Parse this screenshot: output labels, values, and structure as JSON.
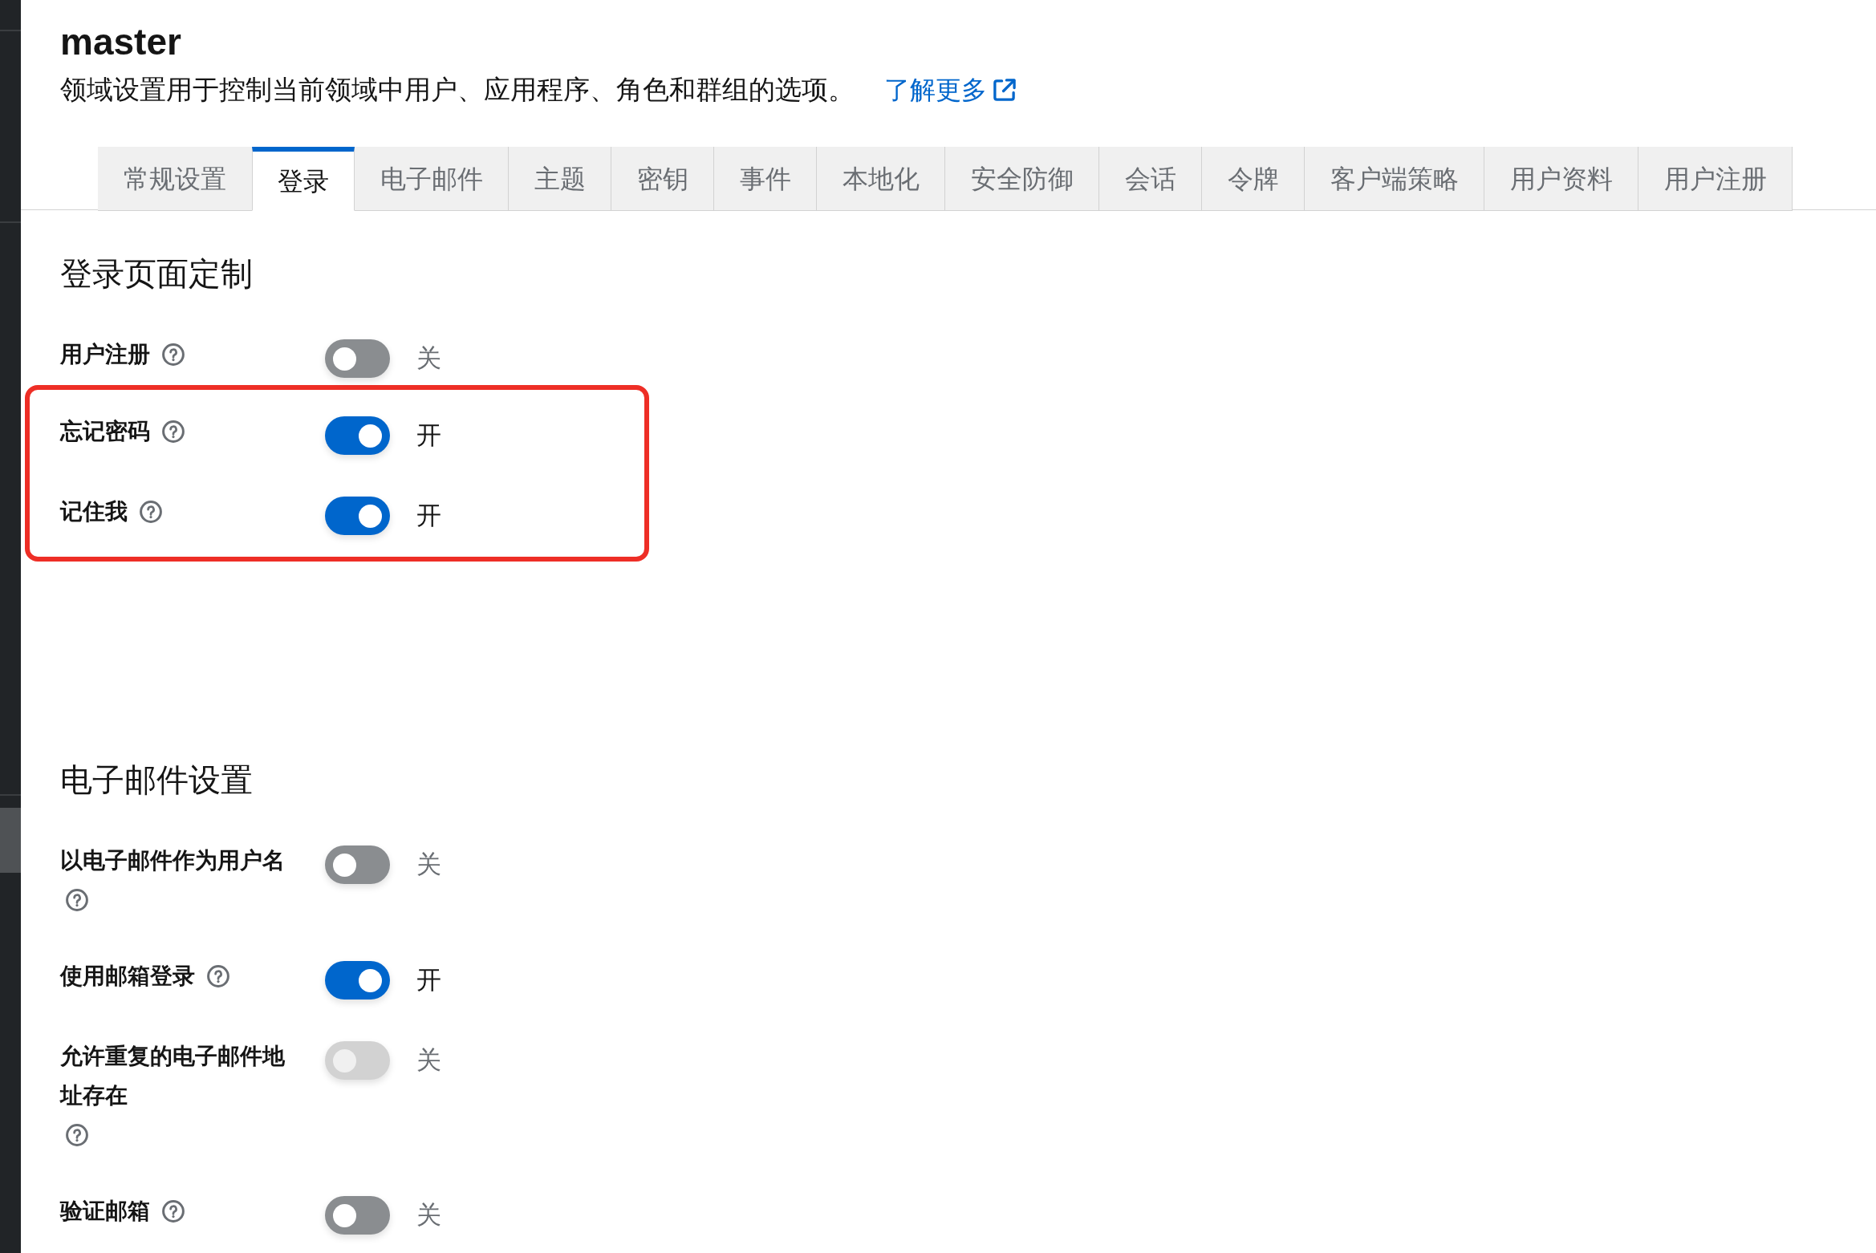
{
  "realm": {
    "title": "master",
    "description": "领域设置用于控制当前领域中用户、应用程序、角色和群组的选项。",
    "learn_more": "了解更多"
  },
  "tabs": [
    {
      "label": "常规设置",
      "selected": false
    },
    {
      "label": "登录",
      "selected": true
    },
    {
      "label": "电子邮件",
      "selected": false
    },
    {
      "label": "主题",
      "selected": false
    },
    {
      "label": "密钥",
      "selected": false
    },
    {
      "label": "事件",
      "selected": false
    },
    {
      "label": "本地化",
      "selected": false
    },
    {
      "label": "安全防御",
      "selected": false
    },
    {
      "label": "会话",
      "selected": false
    },
    {
      "label": "令牌",
      "selected": false
    },
    {
      "label": "客户端策略",
      "selected": false
    },
    {
      "label": "用户资料",
      "selected": false
    },
    {
      "label": "用户注册",
      "selected": false
    }
  ],
  "sections": [
    {
      "heading": "登录页面定制",
      "settings": [
        {
          "label": "用户注册",
          "on": false,
          "disabled": false,
          "state_text": "关",
          "highlighted": false
        },
        {
          "label": "忘记密码",
          "on": true,
          "disabled": false,
          "state_text": "开",
          "highlighted": true
        },
        {
          "label": "记住我",
          "on": true,
          "disabled": false,
          "state_text": "开",
          "highlighted": true
        }
      ]
    },
    {
      "heading": "电子邮件设置",
      "settings": [
        {
          "label": "以电子邮件作为用户名",
          "on": false,
          "disabled": false,
          "state_text": "关",
          "highlighted": false
        },
        {
          "label": "使用邮箱登录",
          "on": true,
          "disabled": false,
          "state_text": "开",
          "highlighted": false
        },
        {
          "label": "允许重复的电子邮件地址存在",
          "on": false,
          "disabled": true,
          "state_text": "关",
          "highlighted": false
        },
        {
          "label": "验证邮箱",
          "on": false,
          "disabled": false,
          "state_text": "关",
          "highlighted": false
        }
      ]
    }
  ]
}
